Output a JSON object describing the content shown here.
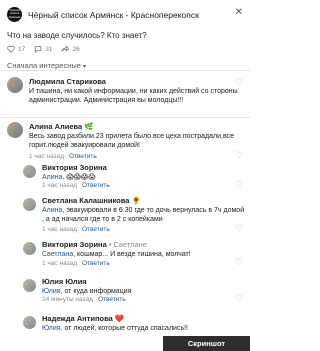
{
  "header": {
    "avatar_text": "Чёрный список Армянск",
    "title": "Чёрный список Армянск - Красноперекопск",
    "close_icon": "close-icon"
  },
  "post": {
    "text": "Что на заводе случилось? Кто знает?",
    "likes": "17",
    "comments": "31",
    "views": "26",
    "filter_label": "Сначала интересные"
  },
  "comments": [
    {
      "name": "Людмила Старикова",
      "text": "И тишина, ни какой информации, ни каких действий со стороны администрации. Администрация вы молодцы!!!"
    },
    {
      "name": "Алина Алиева 🌿",
      "text": "Весь завод разбили.23 прилета было.все цеха пострадали,все горит.людей эвакуировали домой!",
      "time": "1 час назад",
      "action": "Ответить"
    },
    {
      "name": "Виктория Зорина",
      "address": "Алина,",
      "text": " 😱😱😱😱",
      "time": "1 час назад",
      "action": "Ответить"
    },
    {
      "name": "Светлана Калашникова 🌻",
      "address": "Алина,",
      "text": " эвакуировали в 6.30 где то дочь вернулась в 7ч домой , а ад начался где то в 2 с копейками",
      "time": "1 час назад",
      "action": "Ответить"
    },
    {
      "name": "Виктория Зорина",
      "badge": " • Светлане",
      "address": "Светлана,",
      "text": " кошмар... И везде тишина, молчат!",
      "time": "1 час назад",
      "action": "Ответить"
    },
    {
      "name": "Юлия Юлия",
      "address": "Юлия,",
      "text": " от куда информация",
      "time": "24 минуты назад",
      "action": "Ответить"
    },
    {
      "name": "Надежда Антипова ❤️",
      "address": "Юлия,",
      "text": " от людей, которые оттуда спасались!!"
    }
  ],
  "watermark": "Скриншот"
}
